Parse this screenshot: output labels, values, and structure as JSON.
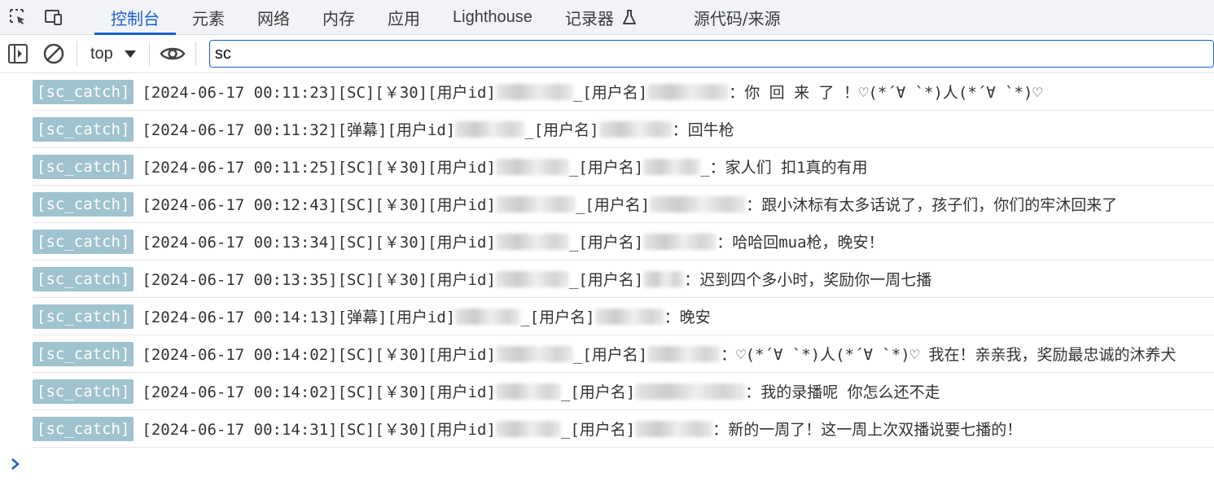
{
  "tabs": [
    {
      "label": "控制台",
      "active": true
    },
    {
      "label": "元素"
    },
    {
      "label": "网络"
    },
    {
      "label": "内存"
    },
    {
      "label": "应用"
    },
    {
      "label": "Lighthouse"
    },
    {
      "label": "记录器"
    },
    {
      "label": "源代码/来源"
    }
  ],
  "toolbar": {
    "context": "top",
    "filter_value": "sc"
  },
  "logs": [
    {
      "tag": "[sc_catch]",
      "pre": "[2024-06-17 00:11:23][SC][￥30][用户id]",
      "mid": "_[用户名]",
      "msg": "：你 回 来 了 ！♡(*´∀ `*)人(*´∀ `*)♡"
    },
    {
      "tag": "[sc_catch]",
      "pre": "[2024-06-17 00:11:32][弹幕][用户id]",
      "mid": "_[用户名]",
      "msg": "：回牛枪"
    },
    {
      "tag": "[sc_catch]",
      "pre": "[2024-06-17 00:11:25][SC][￥30][用户id]",
      "mid": "_[用户名]",
      "msg": "_：家人们 扣1真的有用"
    },
    {
      "tag": "[sc_catch]",
      "pre": "[2024-06-17 00:12:43][SC][￥30][用户id]",
      "mid": "_[用户名]",
      "msg": "：跟小沐标有太多话说了，孩子们，你们的牢沐回来了"
    },
    {
      "tag": "[sc_catch]",
      "pre": "[2024-06-17 00:13:34][SC][￥30][用户id]",
      "mid": "_[用户名]",
      "msg": "：哈哈回mua枪，晚安！"
    },
    {
      "tag": "[sc_catch]",
      "pre": "[2024-06-17 00:13:35][SC][￥30][用户id]",
      "mid": "_[用户名]",
      "msg": "：迟到四个多小时，奖励你一周七播"
    },
    {
      "tag": "[sc_catch]",
      "pre": "[2024-06-17 00:14:13][弹幕][用户id]",
      "mid": "_[用户名]",
      "msg": "：晚安"
    },
    {
      "tag": "[sc_catch]",
      "pre": "[2024-06-17 00:14:02][SC][￥30][用户id]",
      "mid": "_[用户名]",
      "msg": "：♡(*´∀ `*)人(*´∀ `*)♡ 我在！亲亲我，奖励最忠诚的沐养犬"
    },
    {
      "tag": "[sc_catch]",
      "pre": "[2024-06-17 00:14:02][SC][￥30][用户id]",
      "mid": "_[用户名]",
      "msg": "：我的录播呢 你怎么还不走"
    },
    {
      "tag": "[sc_catch]",
      "pre": "[2024-06-17 00:14:31][SC][￥30][用户id]",
      "mid": "_[用户名]",
      "msg": "：新的一周了！这一周上次双播说要七播的！"
    }
  ],
  "icons": {
    "inspect": "inspect-element-icon",
    "device": "device-toolbar-icon",
    "recorder": "flask-icon",
    "sidebar": "sidebar-toggle-icon",
    "clear": "clear-console-icon",
    "eye": "live-expression-icon",
    "prompt": "console-prompt-icon"
  },
  "colors": {
    "accent": "#1a5fd2",
    "tag_bg": "#9fc3cf",
    "tag_text": "#ffffff"
  }
}
